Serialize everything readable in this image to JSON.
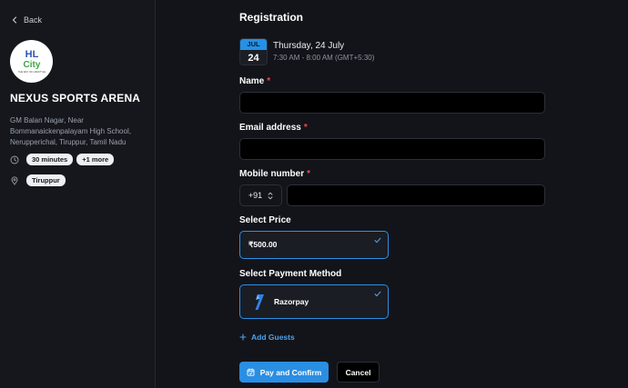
{
  "sidebar": {
    "back_label": "Back",
    "logo": {
      "line1": "HL",
      "line2": "City",
      "tagline": "THE WAY OF LIFESTYLE"
    },
    "venue_name": "NEXUS SPORTS ARENA",
    "address": "GM Balan Nagar, Near Bommanaickenpalayam High School, Nerupperichal, Tiruppur, Tamil Nadu",
    "duration_chip": "30 minutes",
    "more_chip": "+1 more",
    "location_chip": "Tiruppur"
  },
  "main": {
    "title": "Registration",
    "date": {
      "month": "JUL",
      "day": "24",
      "weekday_date": "Thursday, 24 July",
      "time_range": "7:30 AM - 8:00 AM (GMT+5:30)"
    },
    "fields": {
      "name_label": "Name",
      "email_label": "Email address",
      "mobile_label": "Mobile number",
      "required_mark": "*",
      "name_value": "",
      "email_value": "",
      "mobile_value": "",
      "country_code": "+91"
    },
    "price": {
      "label": "Select Price",
      "selected": "₹500.00"
    },
    "payment": {
      "label": "Select Payment Method",
      "selected": "Razorpay"
    },
    "add_guests": "Add Guests",
    "pay_button": "Pay and Confirm",
    "cancel_button": "Cancel"
  },
  "colors": {
    "accent": "#2a8ee3",
    "required": "#f04a4a",
    "background": "#12141a",
    "sidebar": "#15171d"
  },
  "icons": [
    "chevron-left-icon",
    "clock-icon",
    "location-pin-icon",
    "chevron-updown-icon",
    "check-icon",
    "razorpay-icon",
    "plus-icon",
    "calendar-icon"
  ]
}
